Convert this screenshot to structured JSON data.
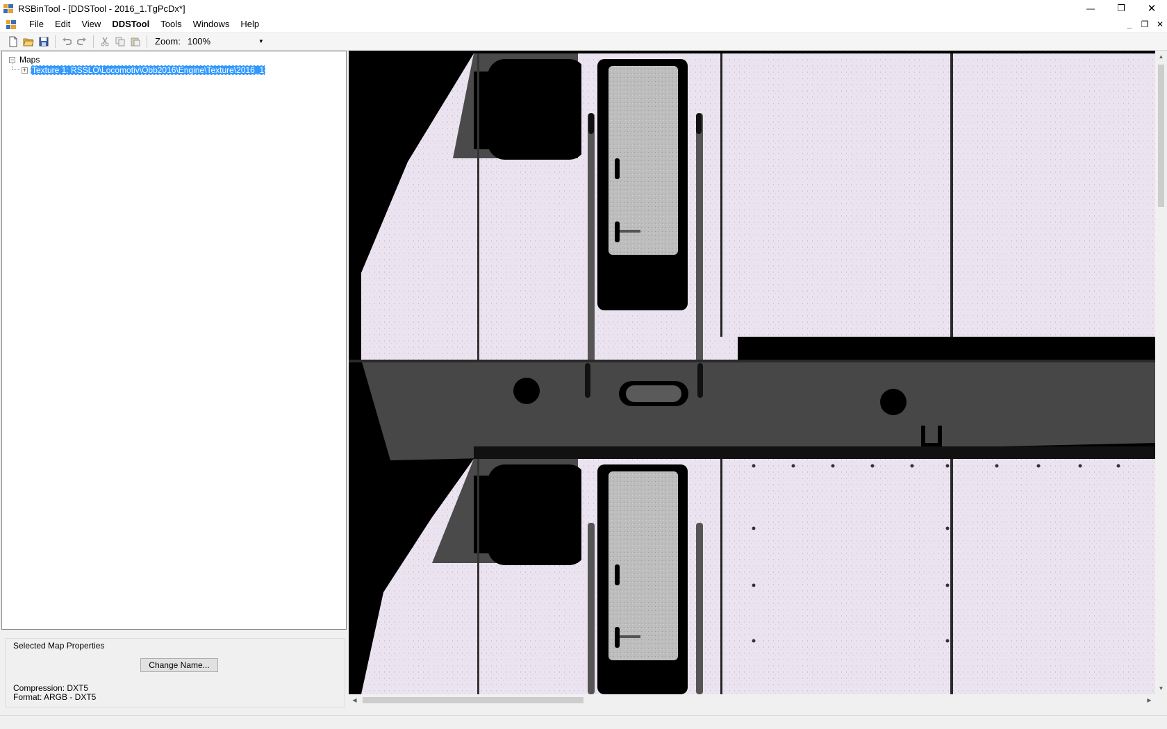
{
  "window": {
    "title": "RSBinTool - [DDSTool - 2016_1.TgPcDx*]",
    "minimize_glyph": "—",
    "restore_glyph": "❐",
    "close_glyph": "✕"
  },
  "menu": {
    "items": [
      {
        "label": "File"
      },
      {
        "label": "Edit"
      },
      {
        "label": "View"
      },
      {
        "label": "DDSTool"
      },
      {
        "label": "Tools"
      },
      {
        "label": "Windows"
      },
      {
        "label": "Help"
      }
    ],
    "mdi_minimize": "_",
    "mdi_restore": "❐",
    "mdi_close": "✕"
  },
  "toolbar": {
    "buttons": [
      "new-icon",
      "open-icon",
      "save-icon",
      "undo-icon",
      "redo-icon",
      "cut-icon",
      "copy-icon",
      "paste-icon"
    ],
    "zoom_label": "Zoom:",
    "zoom_value": "100%"
  },
  "tree": {
    "root_label": "Maps",
    "root_expander": "−",
    "child_label": "Texture 1: RSSLO\\Locomotiv\\Obb2016\\Engine\\Texture\\2016_1",
    "child_expander": "+"
  },
  "properties": {
    "group_title": "Selected Map Properties",
    "change_name_button": "Change Name...",
    "compression": "Compression: DXT5",
    "format": "Format: ARGB - DXT5"
  },
  "viewer": {
    "texture_description": "locomotive-texture-preview",
    "colors": {
      "background": "#000000",
      "panel_pale": "#ece3f0",
      "dark_strip": "#474747",
      "door_window": "#b9b9b9"
    }
  },
  "colors": {
    "selection": "#3399ff",
    "window_bg": "#f0f0f0"
  }
}
